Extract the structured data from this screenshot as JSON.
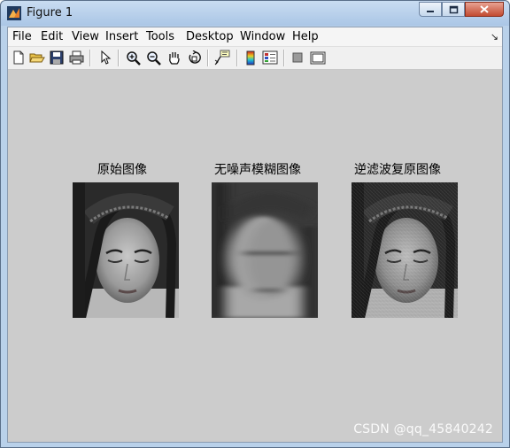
{
  "window": {
    "title": "Figure 1",
    "icon": "matlab-figure-icon"
  },
  "menubar": {
    "items": [
      "File",
      "Edit",
      "View",
      "Insert",
      "Tools",
      "Desktop",
      "Window",
      "Help"
    ],
    "dock_arrow": "↘"
  },
  "toolbar": {
    "buttons": [
      "new-figure",
      "open-file",
      "save",
      "print",
      "edit-plot",
      "zoom-in",
      "zoom-out",
      "pan",
      "rotate-3d",
      "data-cursor",
      "insert-colorbar",
      "insert-legend",
      "hide-plot-tools",
      "show-plot-tools"
    ]
  },
  "figure": {
    "background": "#cccccc",
    "panels": [
      {
        "title": "原始图像",
        "image": "original-portrait"
      },
      {
        "title": "无噪声模糊图像",
        "image": "motion-blurred-portrait"
      },
      {
        "title": "逆滤波复原图像",
        "image": "inverse-filtered-portrait"
      }
    ]
  },
  "watermark": "CSDN @qq_45840242"
}
